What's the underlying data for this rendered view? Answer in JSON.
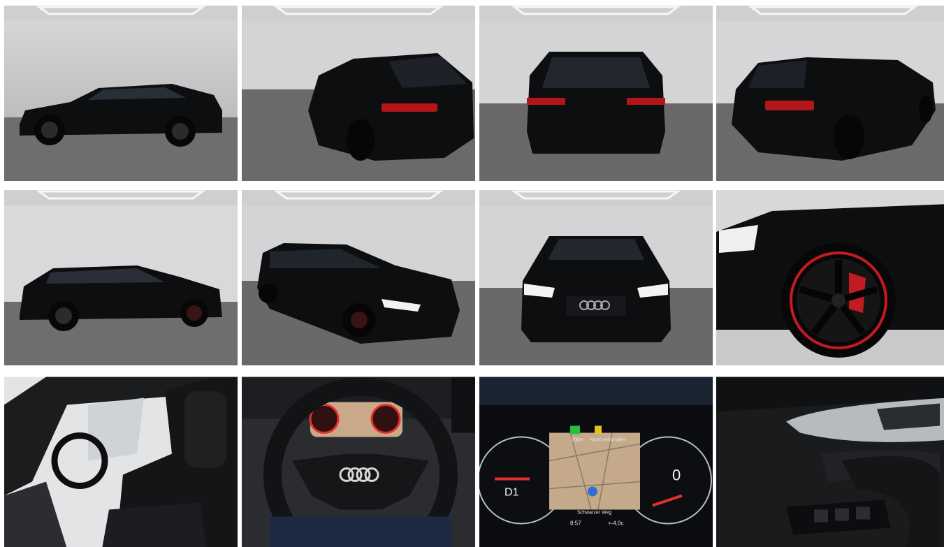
{
  "gallery": {
    "photos": [
      {
        "view": "exterior-side-left",
        "body_color": "#0d0e10",
        "accent": "#b3151b"
      },
      {
        "view": "exterior-rear-three-quarter-left",
        "body_color": "#0d0e10",
        "accent": "#b3151b"
      },
      {
        "view": "exterior-rear",
        "body_color": "#0d0e10",
        "accent": "#b3151b"
      },
      {
        "view": "exterior-rear-three-quarter-right",
        "body_color": "#0d0e10",
        "accent": "#b3151b"
      },
      {
        "view": "exterior-side-right",
        "body_color": "#0d0e10",
        "accent": "#b3151b"
      },
      {
        "view": "exterior-front-three-quarter-left",
        "body_color": "#0d0e10",
        "accent": "#b3151b"
      },
      {
        "view": "exterior-front",
        "body_color": "#0d0e10",
        "accent": "#b3151b"
      },
      {
        "view": "wheel-detail",
        "body_color": "#0d0e10",
        "accent": "#c41a22"
      },
      {
        "view": "interior-driver-seat",
        "body_color": "#1a1b1d",
        "accent": "#9aa3ad"
      },
      {
        "view": "steering-wheel",
        "body_color": "#1a1b1d",
        "accent": "#c0c0c0"
      },
      {
        "view": "instrument-cluster",
        "body_color": "#0a0c10",
        "accent": "#e3302b"
      },
      {
        "view": "door-panel",
        "body_color": "#1a1b1d",
        "accent": "#b7bbc0"
      }
    ]
  },
  "cluster": {
    "gear": "D1",
    "speed": "0",
    "street": "Schwarzer Weg",
    "clock": "8:57",
    "temperature": "+-4,0c",
    "status": "Nicht verbunden",
    "range": "20km"
  }
}
